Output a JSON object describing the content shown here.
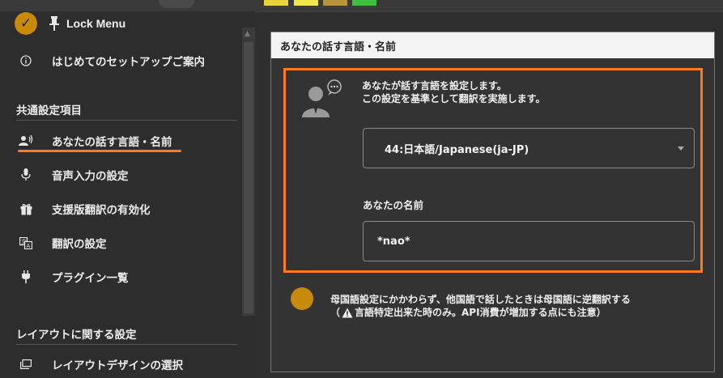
{
  "sidebar": {
    "lock_menu_label": "Lock Menu",
    "setup_guide_label": "はじめてのセットアップご案内",
    "common_section_title": "共通設定項目",
    "items": [
      {
        "label": "あなたの話す言語・名前",
        "icon": "speaker-person-icon"
      },
      {
        "label": "音声入力の設定",
        "icon": "microphone-icon"
      },
      {
        "label": "支援版翻訳の有効化",
        "icon": "gift-icon"
      },
      {
        "label": "翻訳の設定",
        "icon": "translate-icon"
      },
      {
        "label": "プラグイン一覧",
        "icon": "plug-icon"
      }
    ],
    "layout_section_title": "レイアウトに関する設定",
    "layout_items": [
      {
        "label": "レイアウトデザインの選択",
        "icon": "window-layout-icon"
      }
    ]
  },
  "panel": {
    "header": "あなたの話す言語・名前",
    "description_line1": "あなたが話す言語を設定します。",
    "description_line2": "この設定を基準として翻訳を実施します。",
    "language_selected": "44:日本語/Japanese(ja-JP)",
    "name_label": "あなたの名前",
    "name_value": "*nao*",
    "reverse_note_line1": "母国語設定にかかわらず、他国語で話したときは母国語に逆翻訳する",
    "reverse_note_line2_prefix": "（",
    "reverse_note_line2": "言語特定出来た時のみ。API消費が増加する点にも注意）"
  },
  "colors": {
    "accent_orange": "#ff7a1a",
    "toggle_gold": "#c88a0a",
    "background": "#2f2f2f",
    "header_bg": "#f4f4f4"
  }
}
